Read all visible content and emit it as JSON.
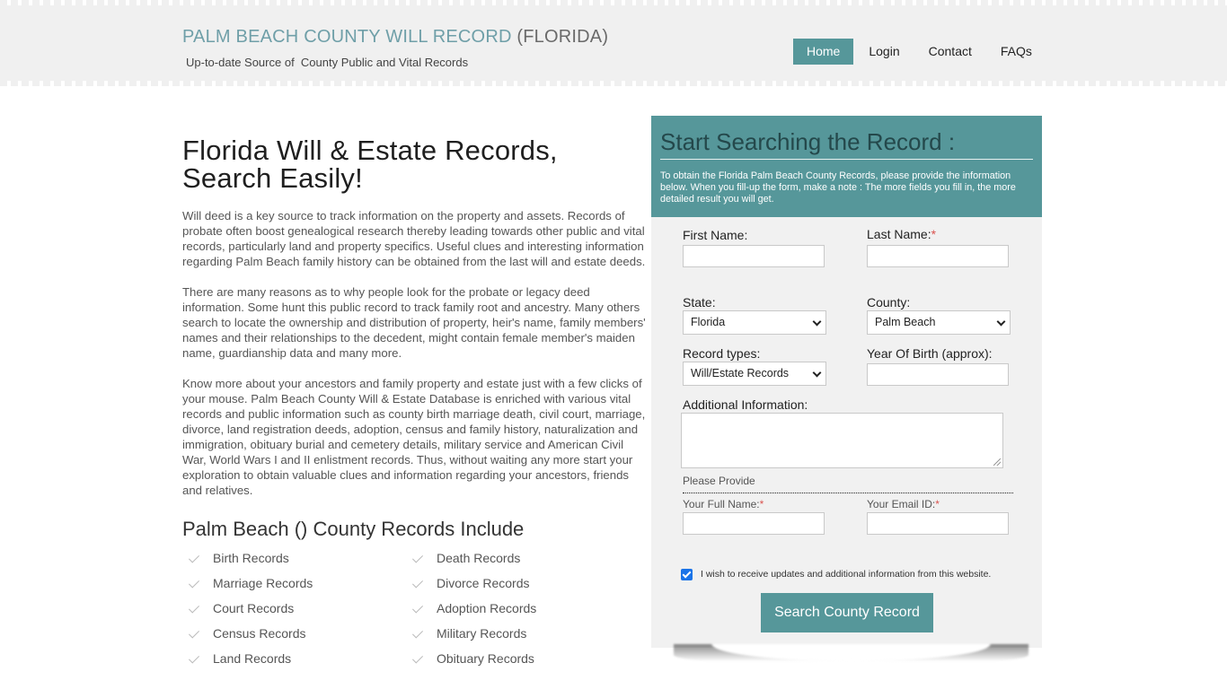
{
  "header": {
    "title_main": "PALM BEACH COUNTY WILL RECORD",
    "title_state": "(FLORIDA)",
    "tagline": "Up-to-date Source of  County Public and Vital Records",
    "accent_color": "#56979a"
  },
  "nav": {
    "items": [
      {
        "label": "Home",
        "active": true
      },
      {
        "label": "Login",
        "active": false
      },
      {
        "label": "Contact",
        "active": false
      },
      {
        "label": "FAQs",
        "active": false
      }
    ]
  },
  "main": {
    "title": "Florida Will & Estate Records, Search Easily!",
    "paragraphs": [
      "Will deed is a key source to track information on the property and assets. Records of probate often boost genealogical research thereby leading towards other public and vital records, particularly land and property specifics. Useful clues and interesting information regarding Palm Beach family history can be obtained from the last will and estate deeds.",
      "There are many reasons as to why people look for the probate or legacy deed information. Some hunt this public record to track family root and ancestry. Many others search to locate the ownership and distribution of property, heir's name, family members' names and their relationships to the decedent, might contain female member's maiden name, guardianship data and many more.",
      "Know more about your ancestors and family property and estate just with a few clicks of your mouse. Palm Beach County Will & Estate Database is enriched with various vital records and public information such as county birth marriage death, civil court, marriage, divorce, land registration deeds, adoption, census and family history, naturalization and immigration, obituary burial and cemetery details, military service and American Civil War, World Wars I and II enlistment records. Thus, without waiting any more start your exploration to obtain valuable clues and information regarding your ancestors, friends and relatives."
    ],
    "records_title": "Palm Beach () County Records Include",
    "records": [
      "Birth Records",
      "Death Records",
      "Marriage Records",
      "Divorce Records",
      "Court Records",
      "Adoption Records",
      "Census Records",
      "Military Records",
      "Land Records",
      "Obituary Records"
    ]
  },
  "form": {
    "title": "Start Searching the Record :",
    "description": "To obtain the Florida Palm Beach County Records, please provide the information below. When you fill-up the form, make a note : The more fields you fill in, the more detailed result you will get.",
    "first_name_label": "First Name:",
    "last_name_label": "Last Name:",
    "required_mark": "*",
    "state_label": "State:",
    "state_value": "Florida",
    "county_label": "County:",
    "county_value": "Palm Beach",
    "record_types_label": "Record types:",
    "record_types_value": "Will/Estate Records",
    "yob_label": "Year Of Birth (approx):",
    "additional_label": "Additional Information:",
    "please_provide": "Please Provide",
    "full_name_label": "Your Full Name:",
    "email_label": "Your Email ID:",
    "updates_checkbox_label": "I wish to receive updates and additional information from this website.",
    "updates_checked": true,
    "submit_label": "Search County Record"
  }
}
